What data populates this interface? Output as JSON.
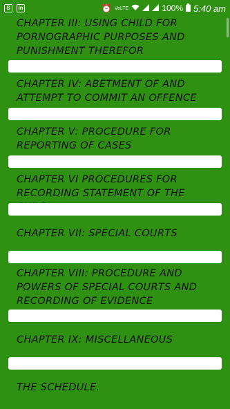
{
  "status_bar": {
    "battery": "100%",
    "time": "5:40 am",
    "network": "VoLTE"
  },
  "chapters": [
    "CHAPTER III: USING CHILD FOR PORNOGRAPHIC PURPOSES AND PUNISHMENT THEREFOR",
    "CHAPTER IV: ABETMENT OF AND ATTEMPT TO COMMIT AN OFFENCE",
    "CHAPTER V: PROCEDURE FOR REPORTING OF CASES",
    "CHAPTER VI PROCEDURES FOR RECORDING STATEMENT OF THE CHILD",
    "CHAPTER VII: SPECIAL COURTS",
    "CHAPTER VIII: PROCEDURE AND POWERS OF SPECIAL COURTS AND RECORDING OF EVIDENCE",
    "CHAPTER IX: MISCELLANEOUS",
    "THE SCHEDULE."
  ],
  "colors": {
    "background": "#2f9112",
    "bar": "#ffffff",
    "text": "#111111"
  }
}
